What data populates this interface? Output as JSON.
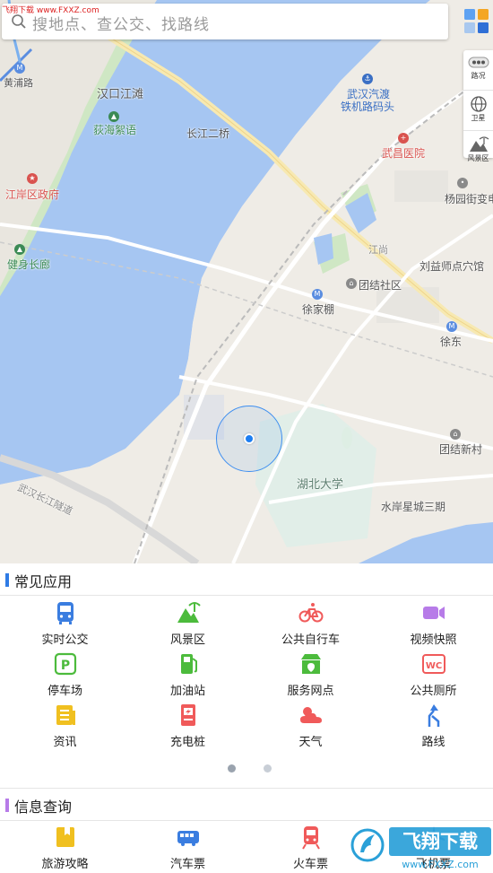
{
  "watermark_top": "飞翔下载 www.FXXZ.com",
  "search": {
    "placeholder": "搜地点、查公交、找路线"
  },
  "map_tools": [
    {
      "label": "路况",
      "icon": "traffic-icon"
    },
    {
      "label": "卫星",
      "icon": "satellite-icon"
    },
    {
      "label": "风景区",
      "icon": "scenic-icon"
    }
  ],
  "map_labels": {
    "hankou_jiangtan": "汉口江滩",
    "yuanhai_fanyu": "荻海絮语",
    "changjiang_bridge": "长江二桥",
    "jiangan_gov": "江岸区政府",
    "huangpu_road": "黄浦路",
    "jianshen_changlang": "健身长廊",
    "wuhan_ferry": "武汉汽渡",
    "rail_ferry": "铁机路码头",
    "wuchang_hospital": "武昌医院",
    "yangyuan_station": "杨园街变电",
    "jiangshang": "江尚",
    "liuyishi": "刘益师点穴馆",
    "tuanjie_community": "团结社区",
    "xujiapeng": "徐家棚",
    "xudong": "徐东",
    "tuanjie_xincun": "团结新村",
    "hubei_university": "湖北大学",
    "shuian_xingcheng": "水岸星城三期",
    "tunnel": "武汉长江隧道"
  },
  "common_apps": {
    "title": "常见应用",
    "accent": "#2f7be5",
    "items": [
      {
        "label": "实时公交",
        "icon": "bus-icon",
        "color": "#3a7de0"
      },
      {
        "label": "风景区",
        "icon": "scenic-icon",
        "color": "#4cbb3c"
      },
      {
        "label": "公共自行车",
        "icon": "bicycle-icon",
        "color": "#f05a5a"
      },
      {
        "label": "视频快照",
        "icon": "video-icon",
        "color": "#b77be8"
      },
      {
        "label": "停车场",
        "icon": "parking-icon",
        "color": "#4cbb3c"
      },
      {
        "label": "加油站",
        "icon": "gas-station-icon",
        "color": "#4cbb3c"
      },
      {
        "label": "服务网点",
        "icon": "service-point-icon",
        "color": "#4cbb3c"
      },
      {
        "label": "公共厕所",
        "icon": "toilet-icon",
        "color": "#f05a5a"
      },
      {
        "label": "资讯",
        "icon": "news-icon",
        "color": "#f0c020"
      },
      {
        "label": "充电桩",
        "icon": "charging-pile-icon",
        "color": "#f05a5a"
      },
      {
        "label": "天气",
        "icon": "weather-icon",
        "color": "#f05a5a"
      },
      {
        "label": "路线",
        "icon": "route-icon",
        "color": "#3a7de0"
      }
    ]
  },
  "pager": {
    "total": 2,
    "current": 1,
    "active_color": "#9aa3ae",
    "inactive_color": "#c8ced6"
  },
  "info_query": {
    "title": "信息查询",
    "accent": "#b77be8",
    "items": [
      {
        "label": "旅游攻略",
        "icon": "travel-guide-icon",
        "color": "#f0c020"
      },
      {
        "label": "汽车票",
        "icon": "coach-ticket-icon",
        "color": "#3a7de0"
      },
      {
        "label": "火车票",
        "icon": "train-ticket-icon",
        "color": "#f05a5a"
      },
      {
        "label": "飞机票",
        "icon": "flight-ticket-icon",
        "color": "#3a7de0"
      }
    ]
  },
  "watermark_bottom": {
    "brand": "飞翔下载",
    "url": "www.FXXZ.com"
  }
}
